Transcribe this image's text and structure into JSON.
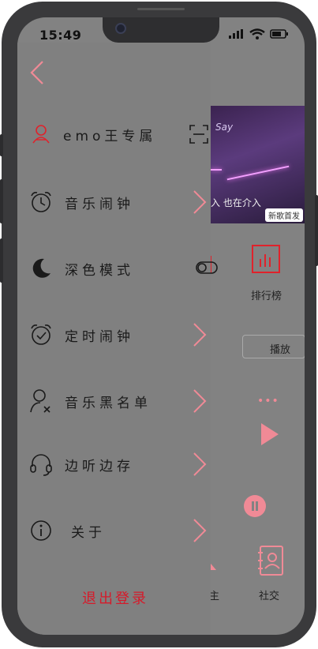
{
  "status_bar": {
    "time": "15:49"
  },
  "background": {
    "album": {
      "script_text": "Say",
      "lyric": "入 也在介入",
      "tag": "新歌首发"
    },
    "rank_label": "排行榜",
    "play_button": "播放",
    "dots": "•••",
    "social_label": "社交",
    "partial_label": "主"
  },
  "drawer": {
    "items": [
      {
        "label": "emo王专属",
        "icon": "user-icon",
        "accessory": "scan-icon"
      },
      {
        "label": "音乐闹钟",
        "icon": "alarm-clock-icon",
        "accessory": "chevron-right-icon"
      },
      {
        "label": "深色模式",
        "icon": "moon-icon",
        "accessory": "toggle-icon"
      },
      {
        "label": "定时闹钟",
        "icon": "timer-clock-icon",
        "accessory": "chevron-right-icon"
      },
      {
        "label": "音乐黑名单",
        "icon": "user-block-icon",
        "accessory": "chevron-right-icon"
      },
      {
        "label": "边听边存",
        "icon": "headphones-icon",
        "accessory": "chevron-right-icon"
      },
      {
        "label": "关于",
        "icon": "info-icon",
        "accessory": "chevron-right-icon"
      }
    ],
    "logout": "退出登录"
  },
  "colors": {
    "accent": "#f08a96",
    "logout": "#d61a2a",
    "overlay": "#808080"
  }
}
